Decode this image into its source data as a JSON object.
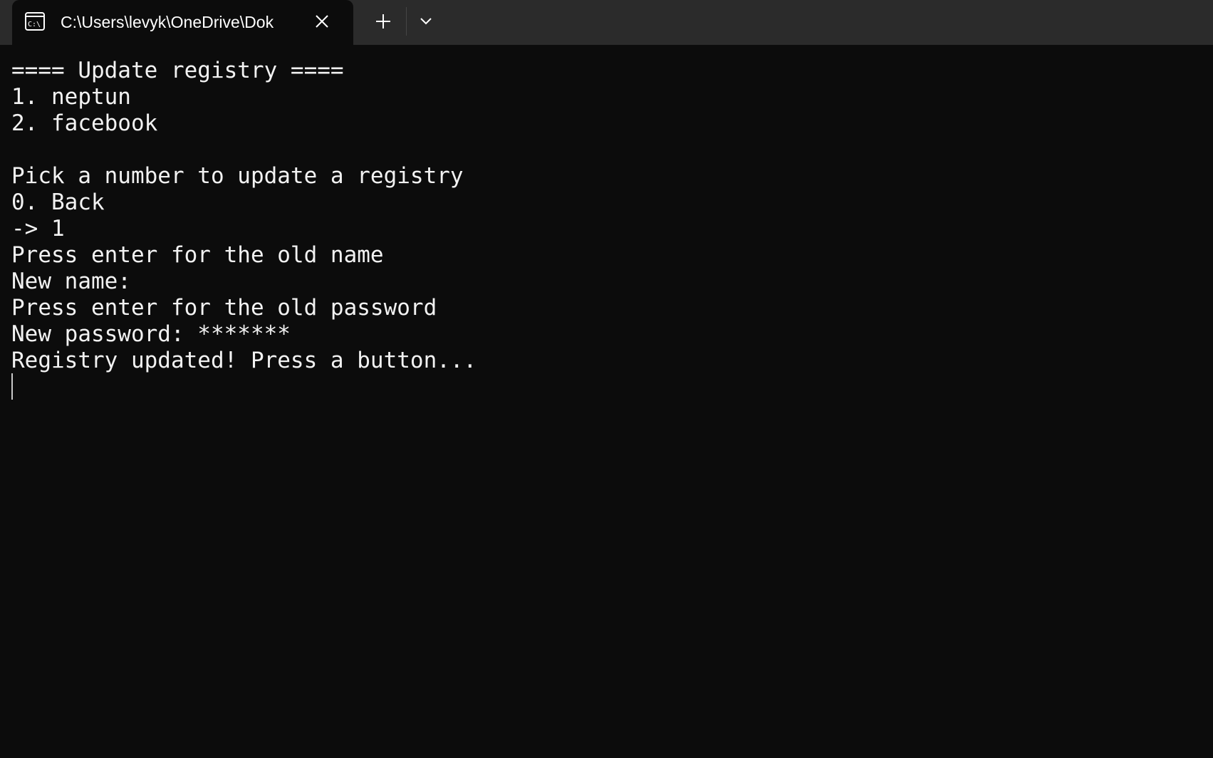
{
  "window": {
    "tab_title": "C:\\Users\\levyk\\OneDrive\\Dok",
    "tab_icon": "terminal-cmd-icon",
    "close_icon": "close-icon",
    "new_tab_icon": "plus-icon",
    "dropdown_icon": "chevron-down-icon",
    "colors": {
      "titlebar": "#2b2b2b",
      "background": "#0c0c0c",
      "text": "#f2f2f2"
    }
  },
  "console": {
    "lines": [
      "==== Update registry ====",
      "1. neptun",
      "2. facebook",
      "",
      "Pick a number to update a registry",
      "0. Back",
      "-> 1",
      "Press enter for the old name",
      "New name:",
      "Press enter for the old password",
      "New password: *******",
      "Registry updated! Press a button..."
    ]
  }
}
